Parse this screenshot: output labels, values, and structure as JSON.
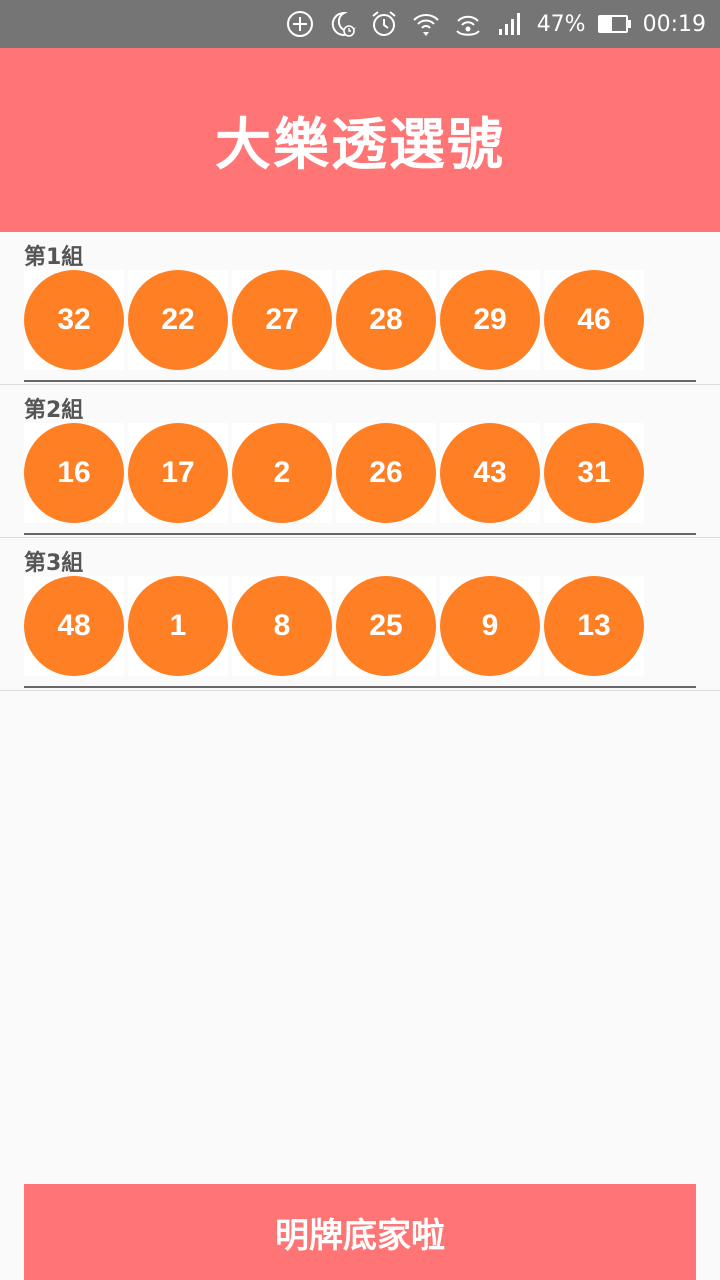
{
  "status_bar": {
    "battery_percent": "47%",
    "time": "00:19",
    "battery_level": 0.47,
    "icons": [
      "add-circle-icon",
      "do-not-disturb-moon-icon",
      "alarm-icon",
      "wifi-icon",
      "hotspot-icon",
      "cell-signal-icon",
      "battery-icon"
    ]
  },
  "header": {
    "title": "大樂透選號"
  },
  "groups": [
    {
      "label": "第1組",
      "numbers": [
        "32",
        "22",
        "27",
        "28",
        "29",
        "46"
      ]
    },
    {
      "label": "第2組",
      "numbers": [
        "16",
        "17",
        "2",
        "26",
        "43",
        "31"
      ]
    },
    {
      "label": "第3組",
      "numbers": [
        "48",
        "1",
        "8",
        "25",
        "9",
        "13"
      ]
    }
  ],
  "bottom_button": {
    "label": "明牌底家啦"
  },
  "colors": {
    "header_bg": "#ff7474",
    "ball": "#ff7f24",
    "status_bar": "#757575"
  }
}
